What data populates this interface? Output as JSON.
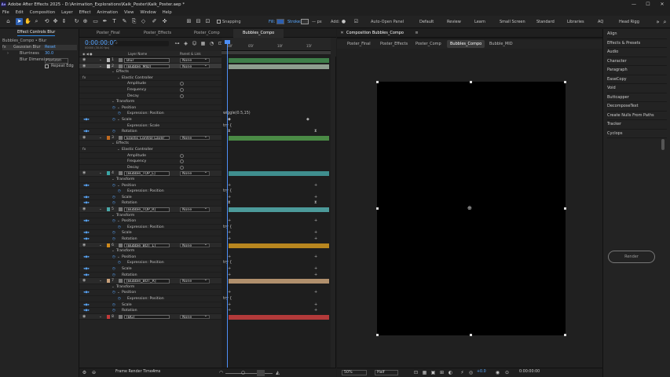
{
  "window": {
    "title": "Adobe After Effects 2025 - D:\\Animation_Explorations\\Kaik_Poster\\Kaik_Poster.aep *",
    "min": "—",
    "max": "☐",
    "close": "✕"
  },
  "menu": [
    "File",
    "Edit",
    "Composition",
    "Layer",
    "Effect",
    "Animation",
    "View",
    "Window",
    "Help"
  ],
  "toolbar": {
    "snapping": "Snapping",
    "fill": "Fill:",
    "stroke": "Stroke:",
    "stroke_px": "— px",
    "add": "Add:",
    "auto_open": "Auto-Open Panel",
    "workspaces": [
      "Default",
      "Review",
      "Learn",
      "Small Screen",
      "Standard",
      "Libraries",
      "AQ",
      "Head Rigg"
    ]
  },
  "effect_controls": {
    "tab": "Effect Controls Blur",
    "comp_path": "Bubbles_Compo • Blur",
    "rows": [
      {
        "fx": "fx",
        "name": "Gaussian Blur",
        "value": "Reset"
      },
      {
        "fx": "",
        "name": "Blurriness",
        "value": "30.0"
      },
      {
        "fx": "",
        "name": "Blur Dimensio",
        "value": "Horizon"
      },
      {
        "fx": "",
        "name": "",
        "value": "Repeat Edg"
      }
    ]
  },
  "timeline": {
    "tabs": [
      "Poster_Final",
      "Poster_Effects",
      "Poster_Comp",
      "Bubbles_Compo"
    ],
    "timecode": "0:00:00:00",
    "timecode_sub": "00000 (30.00 fps)",
    "search_placeholder": "⌕",
    "col_layer": "Layer Name",
    "col_parent": "Parent & Link",
    "ruler_ticks": [
      "00f",
      "05f",
      "10f",
      "15f",
      "20f"
    ],
    "footer": "Frame Render Time:",
    "footer_value": "4ms",
    "rows": [
      {
        "type": "layer",
        "num": "1",
        "name": "Blur",
        "parent": "None",
        "label": "#b7b7b7",
        "bar": "#3f7f4a"
      },
      {
        "type": "layer",
        "num": "2",
        "name": "[Bubble_MID]",
        "parent": "None",
        "label": "#c7c7c7",
        "bar": "#8e9e8f",
        "sel": true
      },
      {
        "type": "prop",
        "indent": 1,
        "name": "Effects",
        "tw": true
      },
      {
        "type": "prop",
        "indent": 2,
        "name": "Elastic Controller",
        "fx": true,
        "tw": true
      },
      {
        "type": "prop",
        "indent": 3,
        "name": "Amplitude",
        "sp": true
      },
      {
        "type": "prop",
        "indent": 3,
        "name": "Frequency",
        "sp": true
      },
      {
        "type": "prop",
        "indent": 3,
        "name": "Decay",
        "sp": true
      },
      {
        "type": "prop",
        "indent": 1,
        "name": "Transform",
        "tw": true
      },
      {
        "type": "prop",
        "indent": 2,
        "name": "Position",
        "tw": true
      },
      {
        "type": "prop",
        "indent": 3,
        "name": "Expression: Position",
        "expr": "wiggle(0.5,15)"
      },
      {
        "type": "prop",
        "indent": 2,
        "name": "Scale",
        "tw": true,
        "kfl": true,
        "kf_mark": "◆"
      },
      {
        "type": "prop",
        "indent": 3,
        "name": "Expression: Scale",
        "expr": "try {"
      },
      {
        "type": "prop",
        "indent": 2,
        "name": "Rotation",
        "kfl": true,
        "kf_mark": "⧗"
      },
      {
        "type": "layer",
        "num": "3",
        "name": "Elastic Control Layer",
        "parent": "None",
        "label": "#c26b1f",
        "bar": "#4a8a45"
      },
      {
        "type": "prop",
        "indent": 1,
        "name": "Effects",
        "tw": true
      },
      {
        "type": "prop",
        "indent": 2,
        "name": "Elastic Controller",
        "fx": true,
        "tw": true
      },
      {
        "type": "prop",
        "indent": 3,
        "name": "Amplitude",
        "sp": true
      },
      {
        "type": "prop",
        "indent": 3,
        "name": "Frequency",
        "sp": true
      },
      {
        "type": "prop",
        "indent": 3,
        "name": "Decay",
        "sp": true
      },
      {
        "type": "layer",
        "num": "4",
        "name": "[Bubble_TOP_L]",
        "parent": "None",
        "label": "#3ba5a5",
        "bar": "#3f8e8e"
      },
      {
        "type": "prop",
        "indent": 1,
        "name": "Transform",
        "tw": true
      },
      {
        "type": "prop",
        "indent": 2,
        "name": "Position",
        "tw": true,
        "kfl": true,
        "kf_mark": "+"
      },
      {
        "type": "prop",
        "indent": 3,
        "name": "Expression: Position",
        "expr": "try {"
      },
      {
        "type": "prop",
        "indent": 2,
        "name": "Scale",
        "kfl": true,
        "kf_mark": "+"
      },
      {
        "type": "prop",
        "indent": 2,
        "name": "Rotation",
        "kfl": true,
        "kf_mark": "⧗"
      },
      {
        "type": "layer",
        "num": "5",
        "name": "[Bubble_TOP_R]",
        "parent": "None",
        "label": "#4aa8a8",
        "bar": "#4c9a9a"
      },
      {
        "type": "prop",
        "indent": 1,
        "name": "Transform",
        "tw": true
      },
      {
        "type": "prop",
        "indent": 2,
        "name": "Position",
        "tw": true,
        "kfl": true,
        "kf_mark": "+"
      },
      {
        "type": "prop",
        "indent": 3,
        "name": "Expression: Position",
        "expr": "try {"
      },
      {
        "type": "prop",
        "indent": 2,
        "name": "Scale",
        "kfl": true,
        "kf_mark": "+"
      },
      {
        "type": "prop",
        "indent": 2,
        "name": "Rotation",
        "kfl": true,
        "kf_mark": "+"
      },
      {
        "type": "layer",
        "num": "6",
        "name": "[Bubble_BOT_L]",
        "parent": "None",
        "label": "#d18b1c",
        "bar": "#b8861f"
      },
      {
        "type": "prop",
        "indent": 1,
        "name": "Transform",
        "tw": true
      },
      {
        "type": "prop",
        "indent": 2,
        "name": "Position",
        "tw": true,
        "kfl": true,
        "kf_mark": "+"
      },
      {
        "type": "prop",
        "indent": 3,
        "name": "Expression: Position",
        "expr": "try {"
      },
      {
        "type": "prop",
        "indent": 2,
        "name": "Scale",
        "kfl": true,
        "kf_mark": "+"
      },
      {
        "type": "prop",
        "indent": 2,
        "name": "Rotation",
        "kfl": true,
        "kf_mark": "+"
      },
      {
        "type": "layer",
        "num": "7",
        "name": "[Bubble_BOT_R]",
        "parent": "None",
        "label": "#c8a07a",
        "bar": "#b1906d"
      },
      {
        "type": "prop",
        "indent": 1,
        "name": "Transform",
        "tw": true
      },
      {
        "type": "prop",
        "indent": 2,
        "name": "Position",
        "tw": true,
        "kfl": true,
        "kf_mark": "+"
      },
      {
        "type": "prop",
        "indent": 3,
        "name": "Expression: Position",
        "expr": "try {"
      },
      {
        "type": "prop",
        "indent": 2,
        "name": "Scale",
        "kfl": true,
        "kf_mark": "+"
      },
      {
        "type": "prop",
        "indent": 2,
        "name": "Rotation",
        "kfl": true,
        "kf_mark": "+"
      },
      {
        "type": "layer",
        "num": "8",
        "name": "[BG]",
        "parent": "None",
        "label": "#c43a3a",
        "bar": "#b33a3a"
      }
    ]
  },
  "composition": {
    "tab": "Composition Bubbles_Compo",
    "crumbs": [
      "Poster_Final",
      "Poster_Effects",
      "Poster_Comp",
      "Bubbles_Compo",
      "Bubble_MID"
    ],
    "active_crumb": "Bubbles_Compo",
    "footer": {
      "zoom": "50%",
      "quality": "Half",
      "exposure": "+0.0",
      "time": "0:00:00:00"
    }
  },
  "panels": [
    "Align",
    "Effects & Presets",
    "Audio",
    "Character",
    "Paragraph",
    "EaseCopy",
    "Void",
    "Buttcapper",
    "DecomposeText",
    "Create Nulls From Paths",
    "Tracker",
    "Cyclops"
  ],
  "cyclops": {
    "render": "Render"
  }
}
